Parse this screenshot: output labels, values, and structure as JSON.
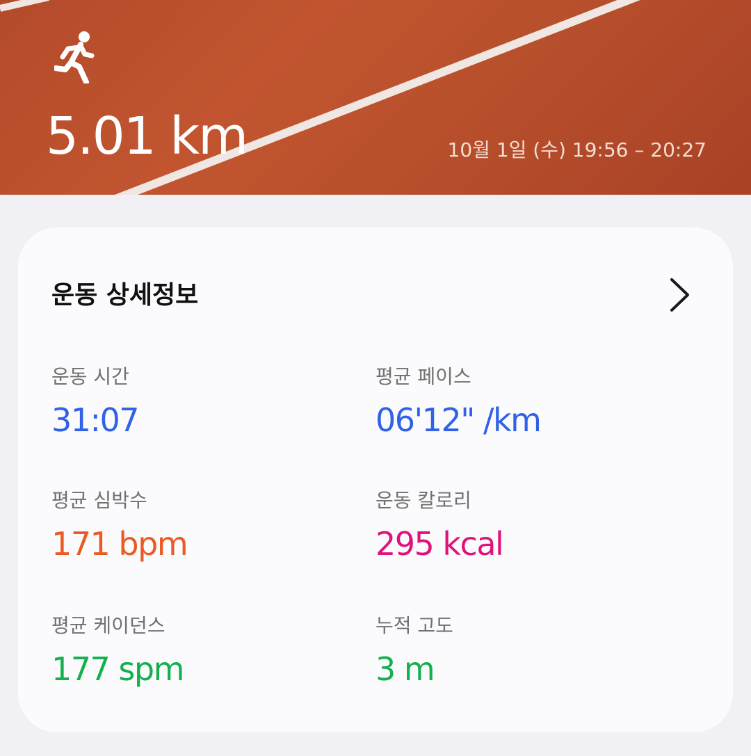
{
  "hero": {
    "icon": "running-person-icon",
    "distance": "5.01 km",
    "datetime": "10월 1일 (수) 19:56 – 20:27"
  },
  "details": {
    "title": "운동 상세정보",
    "chevron_icon": "chevron-right-icon",
    "stats": [
      {
        "label": "운동 시간",
        "value": "31:07",
        "color": "#2f62e6"
      },
      {
        "label": "평균 페이스",
        "value": "06'12\" /km",
        "color": "#2f62e6"
      },
      {
        "label": "평균 심박수",
        "value": "171 bpm",
        "color": "#ec5a24"
      },
      {
        "label": "운동 칼로리",
        "value": "295 kcal",
        "color": "#e0127a"
      },
      {
        "label": "평균 케이던스",
        "value": "177 spm",
        "color": "#15b04d"
      },
      {
        "label": "누적 고도",
        "value": "3 m",
        "color": "#15b04d"
      }
    ]
  }
}
